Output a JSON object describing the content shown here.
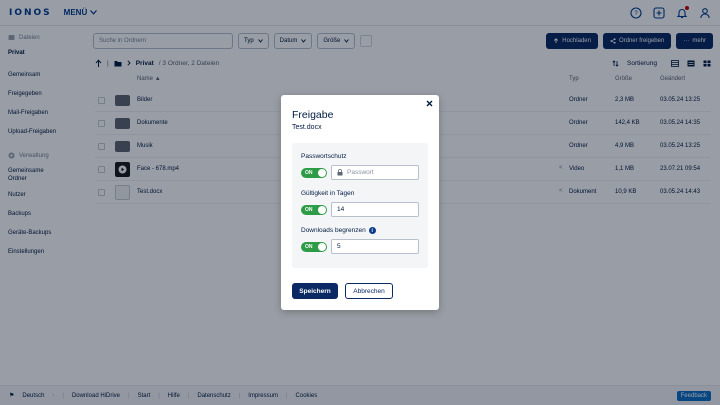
{
  "header": {
    "logo": "IONOS",
    "menu_label": "MENÜ"
  },
  "sidebar": {
    "files_section": "Dateien",
    "items": [
      "Privat",
      "Gemeinsam",
      "Freigegeben",
      "Mail-Freigaben",
      "Upload-Freigaben"
    ],
    "admin_section": "Verwaltung",
    "admin_items": [
      "Gemeinsame Ordner",
      "Nutzer",
      "Backups",
      "Geräte-Backups",
      "Einstellungen"
    ]
  },
  "toolbar": {
    "search_placeholder": "Suche in Ordnern",
    "filters": [
      "Typ",
      "Datum",
      "Größe"
    ],
    "upload_label": "Hochladen",
    "share_folder_label": "Ordner freigeben",
    "more_label": "mehr"
  },
  "breadcrumb": {
    "current": "Privat",
    "summary": "/ 3 Ordner, 2 Dateien",
    "sort_label": "Sortierung"
  },
  "table": {
    "headers": {
      "name": "Name",
      "type": "Typ",
      "size": "Größe",
      "changed": "Geändert"
    },
    "rows": [
      {
        "name": "Bilder",
        "type": "Ordner",
        "size": "2,3 MB",
        "date": "03.05.24 13:25"
      },
      {
        "name": "Dokumente",
        "type": "Ordner",
        "size": "142,4 KB",
        "date": "03.05.24 14:35"
      },
      {
        "name": "Musik",
        "type": "Ordner",
        "size": "4,9 MB",
        "date": "03.05.24 13:25"
      },
      {
        "name": "Face - 678.mp4",
        "type": "Video",
        "size": "1,1 MB",
        "date": "23.07.21 09:54"
      },
      {
        "name": "Test.docx",
        "type": "Dokument",
        "size": "10,9 KB",
        "date": "03.05.24 14:43"
      }
    ]
  },
  "footer": {
    "language": "Deutsch",
    "links": [
      "Download HiDrive",
      "Start",
      "Hilfe",
      "Datenschutz",
      "Impressum",
      "Cookies"
    ],
    "feedback": "Feedback"
  },
  "modal": {
    "title": "Freigabe",
    "subtitle": "Test.docx",
    "password_label": "Passwortschutz",
    "password_placeholder": "Passwort",
    "validity_label": "Gültigkeit in Tagen",
    "validity_value": "14",
    "downloads_label": "Downloads begrenzen",
    "downloads_value": "5",
    "toggle_on": "ON",
    "save": "Speichern",
    "cancel": "Abbrechen",
    "info_glyph": "i"
  },
  "colors": {
    "brand": "#003d8f",
    "primary_button": "#0b2a63",
    "toggle_on": "#2e9c47"
  }
}
